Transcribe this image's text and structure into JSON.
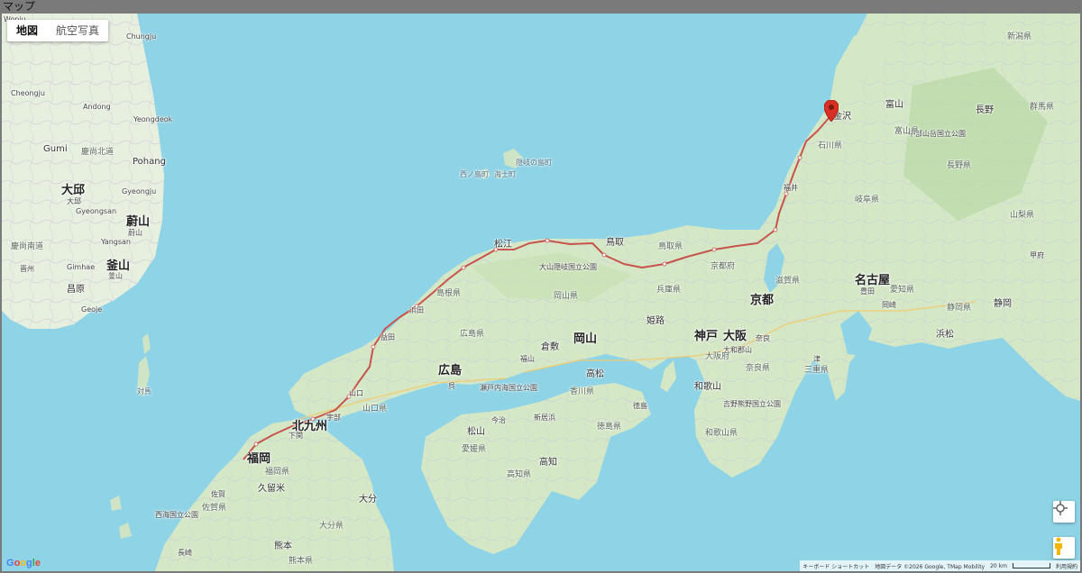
{
  "window": {
    "title": "マップ"
  },
  "map_type": {
    "map_label": "地図",
    "satellite_label": "航空写真"
  },
  "labels": {
    "korea": [
      "Wonju",
      "Chungju",
      "Cheongju",
      "Gumi",
      "Pohang",
      "Andong",
      "Yeongdeok",
      "大邱",
      "大邱",
      "Gyeongsan",
      "Gyeongju",
      "蔚山",
      "蔚山",
      "Yangsan",
      "釜山",
      "釜山",
      "Gimhae",
      "昌原",
      "Geoje",
      "慶尚北道",
      "慶尚南道",
      "晋州"
    ],
    "cities": [
      "金沢",
      "富山",
      "長野",
      "群馬県",
      "福井",
      "石川県",
      "岐阜県",
      "名古屋",
      "豊田",
      "静岡",
      "浜松",
      "京都",
      "大阪",
      "神戸",
      "姫路",
      "岡山",
      "倉敷",
      "福山",
      "広島",
      "呉",
      "松江",
      "鳥取",
      "山口",
      "北九州",
      "福岡",
      "久留米",
      "大分",
      "熊本",
      "高知",
      "高松",
      "松山",
      "徳島",
      "和歌山",
      "奈良",
      "津",
      "岡崎",
      "甲府",
      "浜田",
      "益田",
      "下関",
      "宇部",
      "佐賀",
      "長崎",
      "今治",
      "新居浜",
      "大和郡山"
    ],
    "prefectures": [
      "島根県",
      "鳥取県",
      "兵庫県",
      "京都府",
      "滋賀県",
      "岡山県",
      "広島県",
      "山口県",
      "福岡県",
      "大分県",
      "愛媛県",
      "香川県",
      "徳島県",
      "高知県",
      "奈良県",
      "三重県",
      "和歌山県",
      "愛知県",
      "静岡県",
      "長野県",
      "山梨県",
      "新潟県",
      "富山県",
      "佐賀県",
      "熊本県",
      "大阪府"
    ],
    "seas": [
      "隠岐の島町",
      "西ノ島町",
      "海士町",
      "対馬",
      "大山隠岐国立公園",
      "瀬戸内海国立公園",
      "吉野熊野国立公園",
      "中部山岳国立公園",
      "西海国立公園"
    ]
  },
  "route": {
    "color": "#c7544c"
  },
  "pin": {
    "color": "#d93025"
  },
  "controls": {
    "locate_icon": "target-icon",
    "streetview_icon": "pegman-icon"
  },
  "attribution": {
    "shortcuts": "キーボード ショートカット",
    "data": "地図データ ©2026 Google, TMap Mobility",
    "scale": "20 km",
    "terms": "利用規約"
  },
  "google_logo": "Google"
}
